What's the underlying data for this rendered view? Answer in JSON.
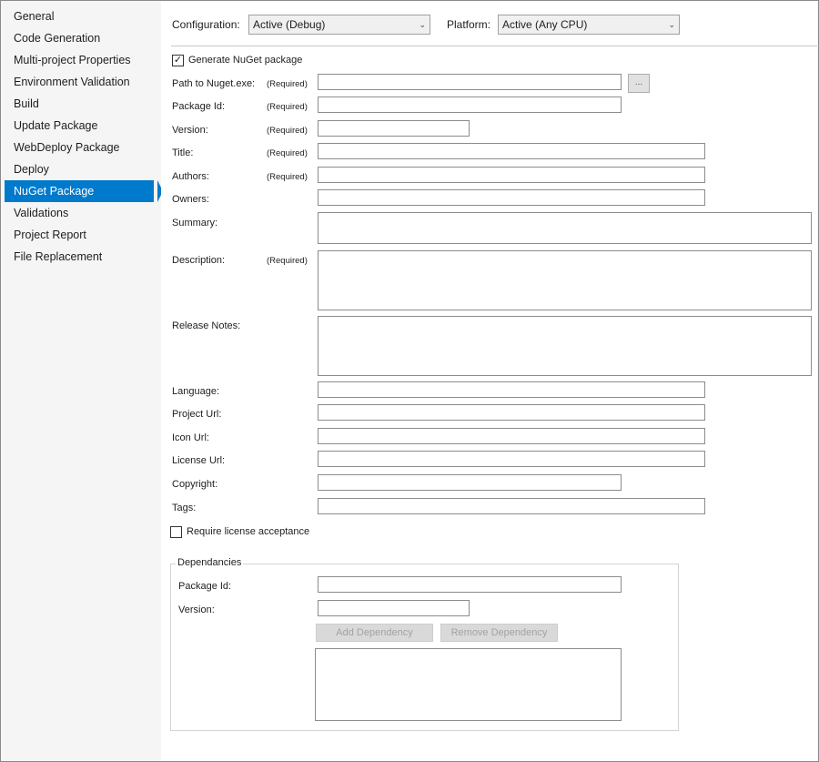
{
  "sidebar": {
    "items": [
      {
        "label": "General"
      },
      {
        "label": "Code Generation"
      },
      {
        "label": "Multi-project Properties"
      },
      {
        "label": "Environment Validation"
      },
      {
        "label": "Build"
      },
      {
        "label": "Update Package"
      },
      {
        "label": "WebDeploy Package"
      },
      {
        "label": "Deploy"
      },
      {
        "label": "NuGet Package"
      },
      {
        "label": "Validations"
      },
      {
        "label": "Project Report"
      },
      {
        "label": "File Replacement"
      }
    ],
    "active_index": 8
  },
  "header": {
    "configuration_label": "Configuration:",
    "configuration_value": "Active (Debug)",
    "platform_label": "Platform:",
    "platform_value": "Active (Any CPU)"
  },
  "nuget": {
    "generate_label": "Generate NuGet package",
    "generate_checked": true,
    "required_text": "(Required)",
    "browse_label": "...",
    "fields": {
      "path": {
        "label": "Path to Nuget.exe:",
        "value": ""
      },
      "package_id": {
        "label": "Package Id:",
        "value": ""
      },
      "version": {
        "label": "Version:",
        "value": ""
      },
      "title": {
        "label": "Title:",
        "value": ""
      },
      "authors": {
        "label": "Authors:",
        "value": ""
      },
      "owners": {
        "label": "Owners:",
        "value": ""
      },
      "summary": {
        "label": "Summary:",
        "value": ""
      },
      "description": {
        "label": "Description:",
        "value": ""
      },
      "release_notes": {
        "label": "Release Notes:",
        "value": ""
      },
      "language": {
        "label": "Language:",
        "value": ""
      },
      "project_url": {
        "label": "Project Url:",
        "value": ""
      },
      "icon_url": {
        "label": "Icon Url:",
        "value": ""
      },
      "license_url": {
        "label": "License Url:",
        "value": ""
      },
      "copyright": {
        "label": "Copyright:",
        "value": ""
      },
      "tags": {
        "label": "Tags:",
        "value": ""
      }
    },
    "require_license_label": "Require license acceptance",
    "require_license_checked": false
  },
  "dependencies": {
    "group_title": "Dependancies",
    "package_id_label": "Package Id:",
    "version_label": "Version:",
    "add_button": "Add Dependency",
    "remove_button": "Remove Dependency"
  },
  "colors": {
    "accent": "#007acc",
    "disabled_button": "#d9d9d9",
    "disabled_text": "#a3a3a3"
  }
}
